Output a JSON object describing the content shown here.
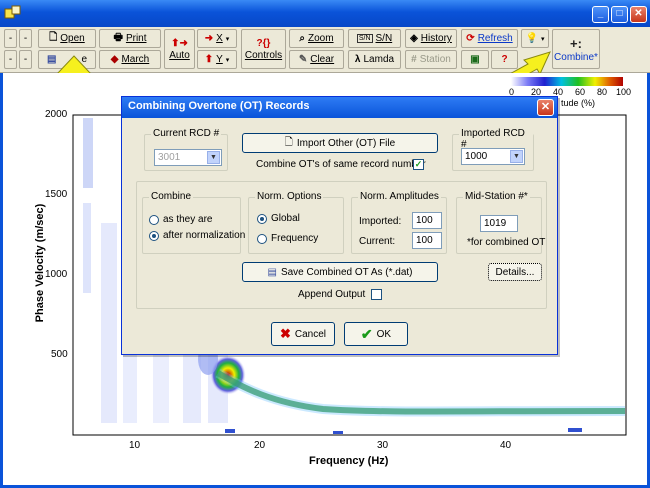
{
  "toolbar": {
    "open": "Open",
    "print": "Print",
    "save_partial": "e",
    "march": "March",
    "auto": "Auto",
    "x_menu": "X",
    "y_menu": "Y",
    "controls": "Controls",
    "zoom": "Zoom",
    "clear": "Clear",
    "sn": "S/N",
    "lamda": "Lamda",
    "history": "History",
    "station": "Station",
    "refresh": "Refresh",
    "combine": "Combine*",
    "minus": "-",
    "question": "?",
    "combine_symbol": "+:"
  },
  "colors": {
    "title_blue": "#0a53d9",
    "dialog_bg": "#ece9d8",
    "arrow_yellow": "#f6f01e"
  },
  "colorbar": {
    "ticks": [
      "0",
      "20",
      "40",
      "60",
      "80",
      "100"
    ],
    "label": "tude (%)"
  },
  "chart": {
    "ylabel": "Phase Velocity (m/sec)",
    "xlabel": "Frequency (Hz)",
    "yticks": [
      "2000",
      "1500",
      "1000",
      "500"
    ],
    "xticks": [
      "10",
      "20",
      "30",
      "40"
    ]
  },
  "dialog": {
    "title": "Combining Overtone (OT) Records",
    "current_rcd_label": "Current RCD #",
    "current_rcd_value": "3001",
    "import_button": "Import Other (OT) File",
    "combine_same_label": "Combine OT's of same record number",
    "combine_same_checked": true,
    "imported_rcd_label": "Imported RCD #",
    "imported_rcd_value": "1000",
    "combine_group": {
      "label": "Combine",
      "options": [
        "as they are",
        "after normalization"
      ],
      "selected": "after normalization"
    },
    "norm_group": {
      "label": "Norm. Options",
      "options": [
        "Global",
        "Frequency"
      ],
      "selected": "Global"
    },
    "amp_group": {
      "label": "Norm. Amplitudes",
      "imported_label": "Imported:",
      "imported_value": "100",
      "current_label": "Current:",
      "current_value": "100"
    },
    "mid_group": {
      "label": "Mid-Station #*",
      "value": "1019",
      "note": "*for combined OT"
    },
    "save_button": "Save Combined OT As (*.dat)",
    "details_button": "Details...",
    "append_label": "Append Output",
    "append_checked": false,
    "cancel_button": "Cancel",
    "ok_button": "OK"
  }
}
